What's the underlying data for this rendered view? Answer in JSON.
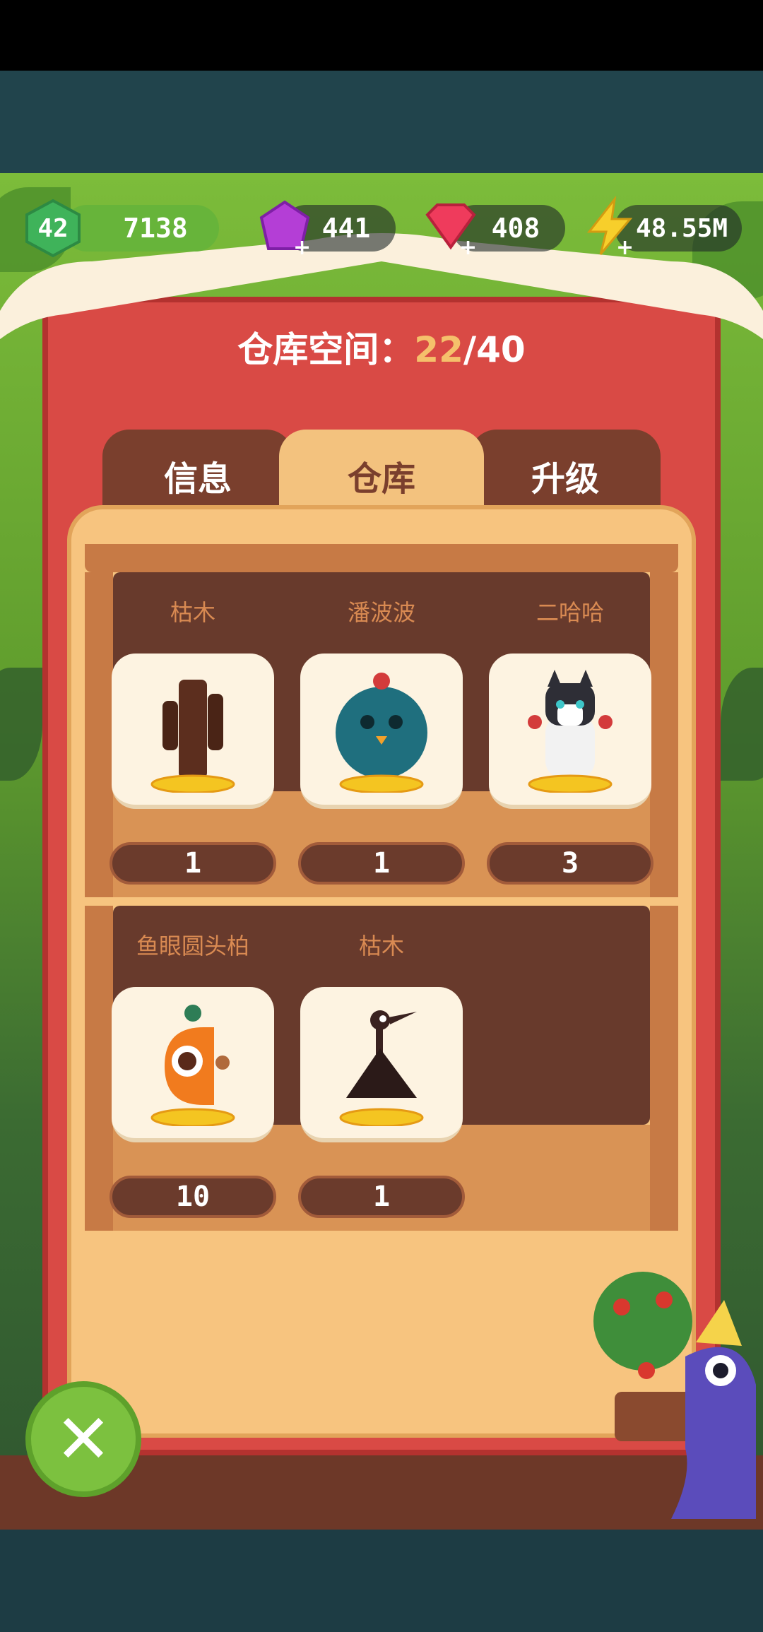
{
  "hud": {
    "level": "42",
    "xp": "7138",
    "purple_gems": "441",
    "red_gems": "408",
    "energy": "48.55M"
  },
  "storage": {
    "label": "仓库空间：",
    "used": "22",
    "total": "/40"
  },
  "tabs": [
    {
      "label": "信息",
      "active": false
    },
    {
      "label": "仓库",
      "active": true
    },
    {
      "label": "升级",
      "active": false
    }
  ],
  "shelves": [
    {
      "items": [
        {
          "name": "枯木",
          "count": "1",
          "icon": "cactus-creature-icon"
        },
        {
          "name": "潘波波",
          "count": "1",
          "icon": "teal-bird-icon"
        },
        {
          "name": "二哈哈",
          "count": "3",
          "icon": "husky-icon"
        }
      ]
    },
    {
      "items": [
        {
          "name": "鱼眼圆头柏",
          "count": "10",
          "icon": "orange-fish-icon"
        },
        {
          "name": "枯木",
          "count": "1",
          "icon": "dark-bird-icon"
        }
      ]
    }
  ],
  "colors": {
    "wall": "#d94a45",
    "panel": "#f7c47f",
    "accent": "#f5c06b",
    "close": "#7cc13f"
  }
}
